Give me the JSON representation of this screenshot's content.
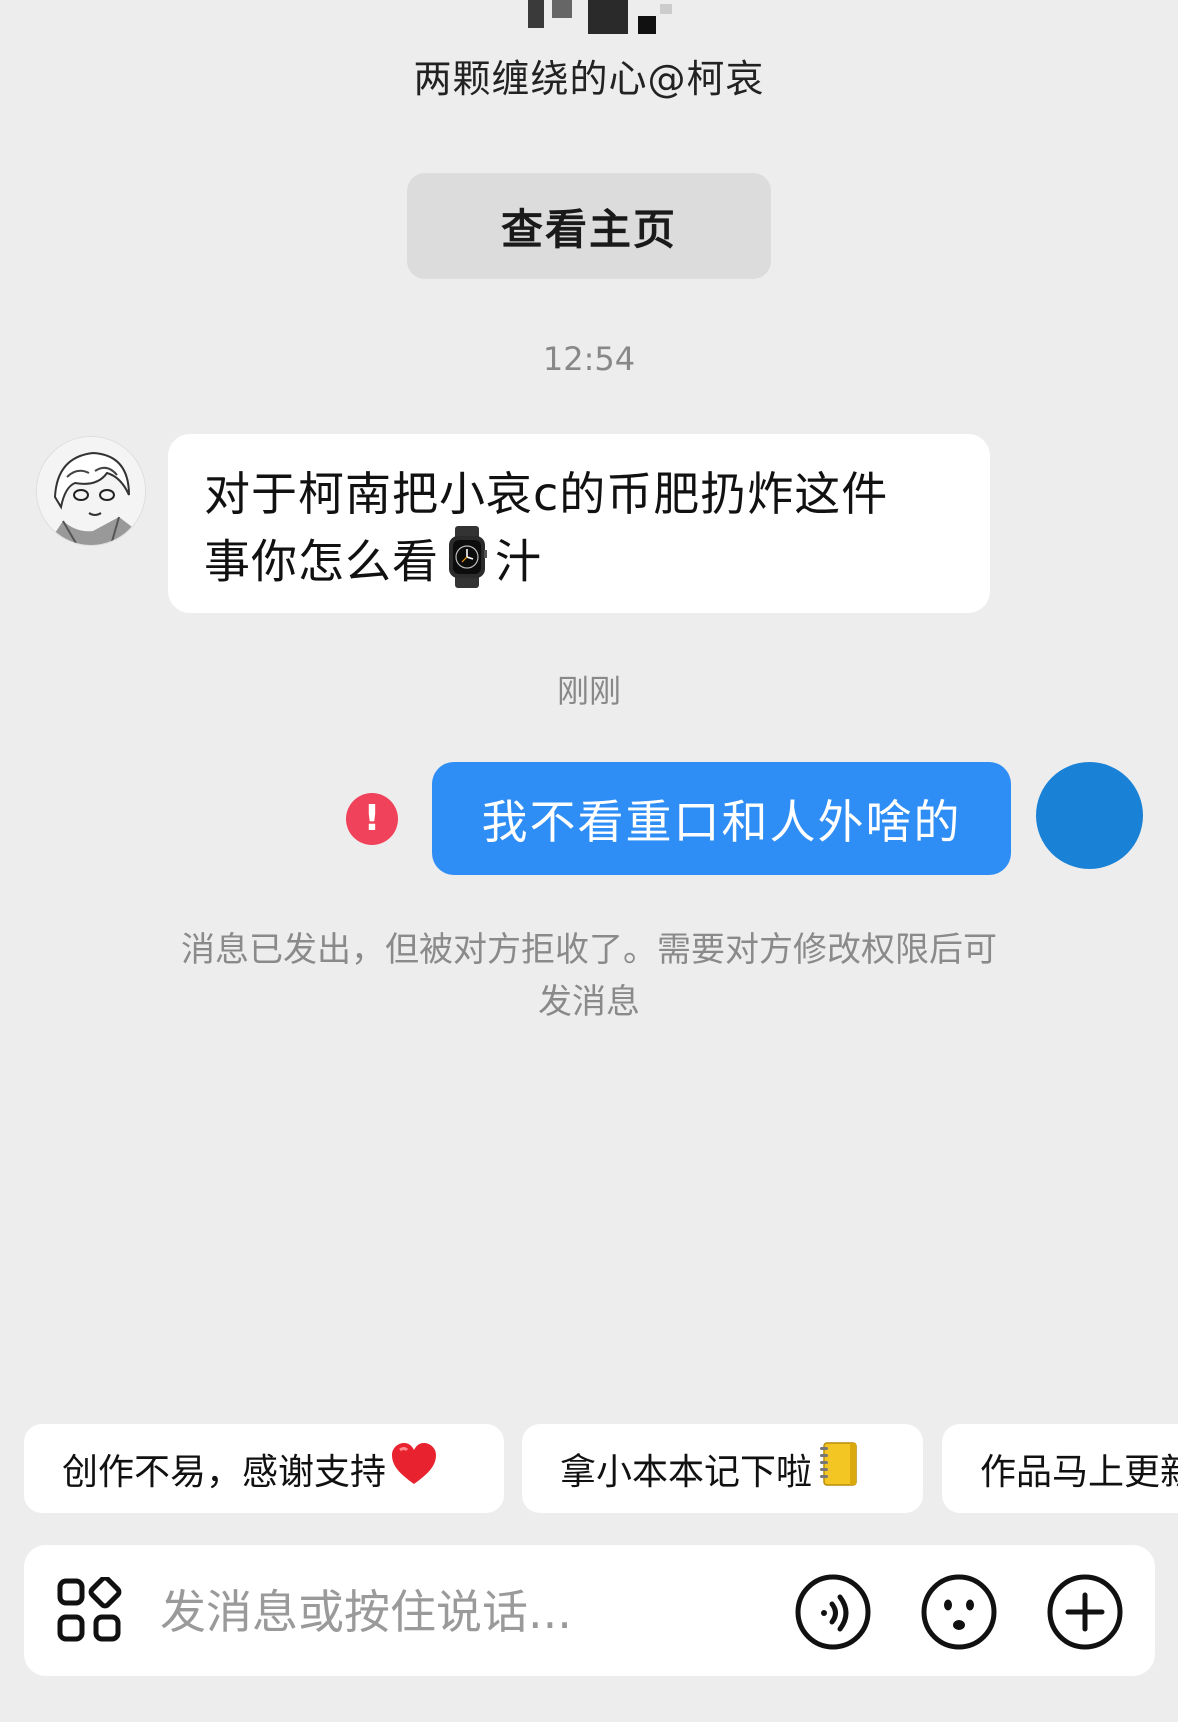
{
  "header": {
    "profile_name": "两颗缠绕的心@柯哀",
    "view_home_label": "查看主页"
  },
  "messages": [
    {
      "timestamp": "12:54",
      "direction": "incoming",
      "text_line1": "对于柯南把小哀c的币肥扔炸这件",
      "text_line2_before": "事你怎么看",
      "inline_icon": "watch-emoji",
      "text_line2_after": "汁"
    },
    {
      "timestamp": "刚刚",
      "direction": "outgoing",
      "text": "我不看重口和人外啥的",
      "status_icon": "error-icon",
      "status_symbol": "!"
    }
  ],
  "system_notice": {
    "line1": "消息已发出，但被对方拒收了。需要对方修改权限后可",
    "line2": "发消息"
  },
  "quick_replies": [
    {
      "label": "创作不易，感谢支持",
      "icon": "red-heart-emoji"
    },
    {
      "label": "拿小本本记下啦",
      "icon": "notebook-emoji"
    },
    {
      "label": "作品马上更新",
      "icon": ""
    }
  ],
  "input_bar": {
    "placeholder": "发消息或按住说话...",
    "icons": [
      "apps-grid-icon",
      "voice-icon",
      "emoji-icon",
      "plus-icon"
    ]
  },
  "colors": {
    "background": "#ededed",
    "outgoing_bubble": "#2f8ef5",
    "error_red": "#f0425a",
    "outgoing_avatar": "#1a82d6"
  }
}
